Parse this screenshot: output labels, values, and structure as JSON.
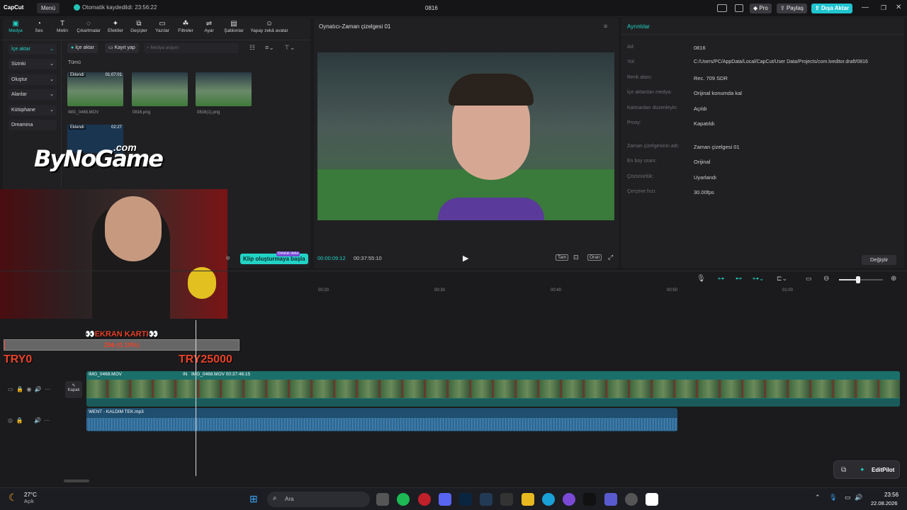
{
  "app": {
    "logo": "CapCut",
    "menu": "Menü",
    "autosave": "Otomatik kaydedildi: 23:56:22",
    "window_title": "0816"
  },
  "header_buttons": {
    "pro": "Pro",
    "share": "Paylaş",
    "export": "Dışa Aktar"
  },
  "toolbar": [
    "Medya",
    "Ses",
    "Metin",
    "Çıkartmalar",
    "Efektler",
    "Geçişler",
    "Yazılar",
    "Filtreler",
    "Ayar",
    "Şablonlar",
    "Yapay zekâ avatar"
  ],
  "sidebar": [
    "İçe aktar",
    "Sizinki",
    "Oluştur",
    "Alanlar",
    "Kütüphane",
    "Dreamina"
  ],
  "media": {
    "import_button": "İçe aktar",
    "record_button": "Kayıt yap",
    "search_placeholder": "Medya arayın",
    "filter_all": "Tümü",
    "items": [
      {
        "name": "IMG_0468.MOV",
        "badge": "Eklendi",
        "duration": "01:07:01"
      },
      {
        "name": "0816.png"
      },
      {
        "name": "0816(1).png"
      },
      {
        "name": "",
        "badge": "Eklendi",
        "duration": "02:27"
      }
    ]
  },
  "overlay": {
    "watermark": "ByNoGame",
    "watermark_suffix": ".com",
    "gpu_label": "EKRAN KARTI",
    "progress_text": "25₺ (0.10%)",
    "progress_fraction": 0.001,
    "min_label": "TRY0",
    "max_label": "TRY25000",
    "clip_button": "Klip oluşturmaya başla",
    "clip_badge": "Doluluk daha"
  },
  "player": {
    "title": "Oynatıcı-Zaman çizelgesi 01",
    "current_time": "00:00:09:12",
    "total_time": "00:37:55:10",
    "full_label": "Tam",
    "ratio_label": "Oran"
  },
  "details": {
    "title": "Ayrıntılar",
    "rows": [
      {
        "k": "Ad:",
        "v": "0816"
      },
      {
        "k": "Yol:",
        "v": "C:/Users/PC/AppData/Local/CapCut/User Data/Projects/com.lveditor.draft/0816"
      },
      {
        "k": "Renk alanı:",
        "v": "Rec. 709 SDR"
      },
      {
        "k": "İçe aktarılan medya:",
        "v": "Orijinal konumda kal"
      },
      {
        "k": "Katmanları düzenleyin:",
        "v": "Açıldı"
      },
      {
        "k": "Proxy:",
        "v": "Kapatıldı"
      },
      {
        "k": "Zaman çizelgesinin adı:",
        "v": "Zaman çizelgesi 01"
      },
      {
        "k": "En boy oranı:",
        "v": "Orijinal"
      },
      {
        "k": "Çözünürlük:",
        "v": "Uyarlandı"
      },
      {
        "k": "Çerçeve hızı:",
        "v": "30.00fps"
      }
    ],
    "change_button": "Değiştir"
  },
  "timeline": {
    "ruler": [
      "00:20",
      "00:30",
      "00:40",
      "00:50",
      "01:00"
    ],
    "cover_label": "Kapak",
    "video_clip1": "IMG_0468.MOV",
    "video_clip2": "IMG_0468.MOV  00:37:46:15",
    "video_clip2_prefix": "IN",
    "audio_clip": "WENT - KALDIM TEK.mp3"
  },
  "editpilot": "EditPilot",
  "taskbar": {
    "temp": "27°C",
    "weather": "Açık",
    "search": "Ara",
    "time": "23:56",
    "date": "22.08.2026"
  },
  "colors": {
    "accent": "#22d3c5",
    "export": "#1fc4cf",
    "timeline_video": "#1b6f6b",
    "timeline_audio": "#1f4e6e"
  }
}
